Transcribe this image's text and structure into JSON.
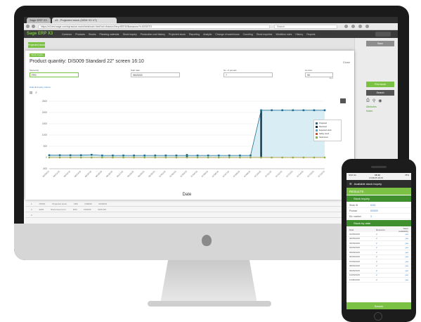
{
  "browser": {
    "tabs": [
      "Sage ERP X3",
      "x3 - Projected stock (DEM X3 V7)"
    ],
    "url": "https://x3.test.sage.com/syracuse-main/html/main.html?url=/trans/x3/erp/SEED/$sessions?f=GESSTO",
    "search_placeholder": "Search"
  },
  "app": {
    "logo": "Sage ERP X3",
    "nav": [
      "Common",
      "Products",
      "Stocks",
      "Planning calendar",
      "Stock inquiry",
      "Production cost history",
      "Projected stock",
      "Reporting",
      "Analytic",
      "Change of warehouse",
      "Counting",
      "Stock inquiries",
      "Workflow rules",
      "History",
      "Reports"
    ],
    "breadcrumb": "Projected stock"
  },
  "dialog": {
    "tag": "Stock inquiry",
    "title": "Product quantity: DIS009 Standard 22\" screen 16:10",
    "close_label": "Close",
    "fields": [
      {
        "label": "Site/entity",
        "value": "FR0",
        "hint": ""
      },
      {
        "label": "Start date",
        "value": "06/20/15",
        "hint": ""
      },
      {
        "label": "No. of periods",
        "value": "7",
        "hint": ""
      },
      {
        "label": "Horizon",
        "value": "90",
        "hint": "days"
      }
    ],
    "show_link": "Hide all inquiry criteria"
  },
  "chart_data": {
    "type": "area",
    "xlabel": "Date",
    "ylabel": "",
    "ylim": [
      -500,
      2500
    ],
    "yticks": [
      -500,
      0,
      500,
      1000,
      1500,
      2000,
      2500
    ],
    "x": [
      "06/20/15",
      "06/21/15",
      "06/22/15",
      "06/23/15",
      "06/24/15",
      "06/25/15",
      "06/26/15",
      "06/27/15",
      "06/28/15",
      "06/29/15",
      "06/30/15",
      "07/01/15",
      "07/02/15",
      "07/03/15",
      "07/04/15",
      "07/05/15",
      "07/06/15",
      "07/07/15",
      "07/08/15",
      "07/09/15",
      "07/10/15",
      "07/11/15",
      "07/12/15",
      "07/13/15",
      "07/14/15",
      "07/15/15",
      "07/16/15"
    ],
    "series": [
      {
        "name": "Projected",
        "color": "#1f6f92",
        "values": [
          100,
          100,
          100,
          100,
          120,
          90,
          90,
          90,
          90,
          90,
          90,
          90,
          90,
          90,
          90,
          90,
          90,
          90,
          90,
          90,
          2100,
          2100,
          2100,
          2100,
          2100,
          2100,
          2100
        ]
      },
      {
        "name": "Received",
        "color": "#11324a",
        "values": [
          0,
          0,
          0,
          0,
          0,
          0,
          0,
          0,
          0,
          0,
          0,
          0,
          0,
          150,
          0,
          0,
          0,
          0,
          0,
          0,
          2100,
          0,
          0,
          0,
          0,
          0,
          0
        ]
      },
      {
        "name": "Expected stock",
        "color": "#4aa5c8",
        "values": [
          100,
          100,
          100,
          100,
          120,
          90,
          90,
          90,
          90,
          90,
          90,
          90,
          90,
          90,
          90,
          90,
          90,
          90,
          90,
          90,
          2100,
          2100,
          2100,
          2100,
          2100,
          2100,
          2100
        ]
      },
      {
        "name": "Safety stock",
        "color": "#e8491d",
        "values": [
          0,
          0,
          0,
          0,
          0,
          0,
          0,
          0,
          0,
          0,
          0,
          0,
          0,
          0,
          0,
          0,
          0,
          0,
          0,
          0,
          0,
          0,
          0,
          0,
          0,
          0,
          0
        ]
      },
      {
        "name": "Stock level",
        "color": "#6fbf3a",
        "values": [
          0,
          0,
          0,
          0,
          0,
          0,
          0,
          0,
          0,
          0,
          0,
          0,
          0,
          0,
          0,
          0,
          0,
          0,
          0,
          0,
          0,
          0,
          0,
          0,
          0,
          0,
          0
        ]
      }
    ]
  },
  "right_panel": {
    "top_button": "Save",
    "action_primary": "First stock",
    "action_secondary": "Search",
    "links": [
      "Attributes",
      "Notes"
    ]
  },
  "bg_table": [
    [
      "1",
      "PROD",
      "Projected stock",
      "FR0",
      "DIS009",
      "06/20/15"
    ],
    [
      "2",
      "ERR",
      "Stock level error",
      "FR0",
      "DIS009",
      "06/21/15"
    ],
    [
      "3",
      "",
      "",
      "",
      "",
      ""
    ]
  ],
  "phone": {
    "carrier": "SFR 4G",
    "time": "18:43",
    "date": "17/06/15 18:43",
    "battery": "78%",
    "header": "Available stock inquiry",
    "results": "RESULTS",
    "section1": "Stock inquiry",
    "kv": [
      {
        "k": "Stock ID",
        "v": "K001"
      },
      {
        "k": "Product",
        "v": "DIS009"
      },
      {
        "k": "Div. number",
        "v": "3"
      }
    ],
    "section2": "Stock by date",
    "table_headers": [
      "Date",
      "Resource",
      "Sales availability"
    ],
    "rows": [
      [
        "01/06/2015",
        "2",
        "yes"
      ],
      [
        "02/06/2015",
        "2",
        "yes"
      ],
      [
        "03/06/2015",
        "2",
        "yes"
      ],
      [
        "04/06/2015",
        "2",
        "yes"
      ],
      [
        "05/06/2015",
        "2",
        "yes"
      ],
      [
        "06/06/2015",
        "2",
        "yes"
      ],
      [
        "07/06/2015",
        "2",
        "yes"
      ],
      [
        "08/06/2015",
        "2",
        "yes"
      ],
      [
        "09/06/2015",
        "2",
        "yes"
      ],
      [
        "10/06/2015",
        "2",
        "yes"
      ],
      [
        "11/06/2015",
        "2",
        "yes"
      ]
    ],
    "search_button": "Search"
  }
}
